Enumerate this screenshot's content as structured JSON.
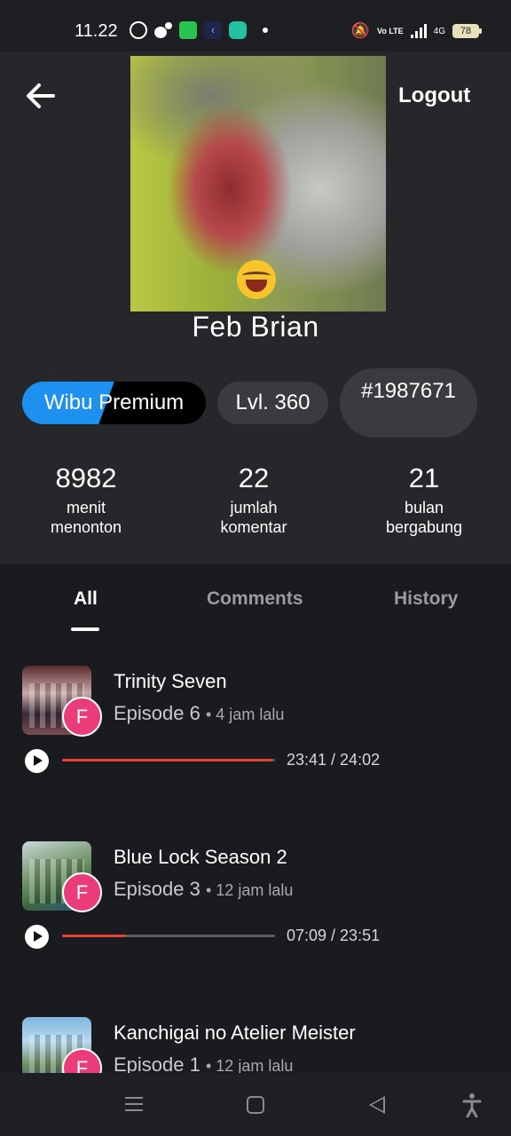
{
  "status_bar": {
    "time": "11.22",
    "network": "4G",
    "volte": "Vo LTE",
    "battery": "78"
  },
  "header": {
    "logout_label": "Logout"
  },
  "profile": {
    "name": "Feb Brian",
    "badges": {
      "membership": "Wibu Premium",
      "level": "Lvl. 360",
      "rank": "#1987671"
    },
    "stats": [
      {
        "value": "8982",
        "label_line1": "menit",
        "label_line2": "menonton"
      },
      {
        "value": "22",
        "label_line1": "jumlah",
        "label_line2": "komentar"
      },
      {
        "value": "21",
        "label_line1": "bulan",
        "label_line2": "bergabung"
      }
    ]
  },
  "tabs": [
    {
      "label": "All",
      "active": true
    },
    {
      "label": "Comments",
      "active": false
    },
    {
      "label": "History",
      "active": false
    }
  ],
  "history": [
    {
      "title": "Trinity Seven",
      "episode": "Episode 6",
      "ago": "4 jam lalu",
      "user_initial": "F",
      "progress_text": "23:41 / 24:02",
      "progress": 0.985
    },
    {
      "title": "Blue Lock Season 2",
      "episode": "Episode 3",
      "ago": "12 jam lalu",
      "user_initial": "F",
      "progress_text": "07:09 / 23:51",
      "progress": 0.3
    },
    {
      "title": "Kanchigai no Atelier Meister",
      "episode": "Episode 1",
      "ago": "12 jam lalu",
      "user_initial": "F",
      "progress_text": "",
      "progress": null
    }
  ],
  "colors": {
    "accent_blue": "#1e90ef",
    "progress_red": "#e8413a",
    "avatar_pink": "#e93c78"
  },
  "icons": {
    "back": "arrow-left-icon",
    "play": "play-icon",
    "nav_menu": "menu-icon",
    "nav_home": "home-icon",
    "nav_back": "back-triangle-icon",
    "accessibility": "accessibility-icon"
  }
}
